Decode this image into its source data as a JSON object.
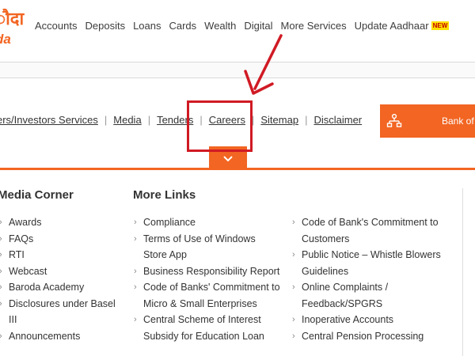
{
  "logo": {
    "hindi": "ौदा",
    "english": "da"
  },
  "main_nav": [
    {
      "label": "Accounts"
    },
    {
      "label": "Deposits"
    },
    {
      "label": "Loans"
    },
    {
      "label": "Cards"
    },
    {
      "label": "Wealth"
    },
    {
      "label": "Digital"
    },
    {
      "label": "More Services"
    },
    {
      "label": "Update Aadhaar",
      "badge": "NEW"
    }
  ],
  "sub_links": [
    "ers/Investors Services",
    "Media",
    "Tenders",
    "Careers",
    "Sitemap",
    "Disclaimer"
  ],
  "bank_button": {
    "label": "Bank of"
  },
  "colors": {
    "brand_orange": "#f26522",
    "annotation_red": "#d01a24",
    "badge_yellow": "#ffe000"
  },
  "columns": {
    "media_corner": {
      "title": "Media Corner",
      "items": [
        "Awards",
        "FAQs",
        "RTI",
        "Webcast",
        "Baroda Academy",
        "Disclosures under Basel III",
        "Announcements"
      ]
    },
    "more_links": {
      "title": "More Links",
      "items": [
        "Compliance",
        "Terms of Use of Windows Store App",
        "Business Responsibility Report",
        "Code of Banks' Commitment to Micro & Small Enterprises",
        "Central Scheme of Interest Subsidy for Education Loan"
      ]
    },
    "more_links_2": {
      "items": [
        "Code of Bank's Commitment to Customers",
        "Public Notice – Whistle Blowers Guidelines",
        "Online Complaints / Feedback/SPGRS",
        "Inoperative Accounts",
        "Central Pension Processing"
      ]
    }
  },
  "icons": {
    "toggle": "chevron-down-icon",
    "bank_button": "network-icon",
    "list_bullet": "chevron-right-icon"
  }
}
